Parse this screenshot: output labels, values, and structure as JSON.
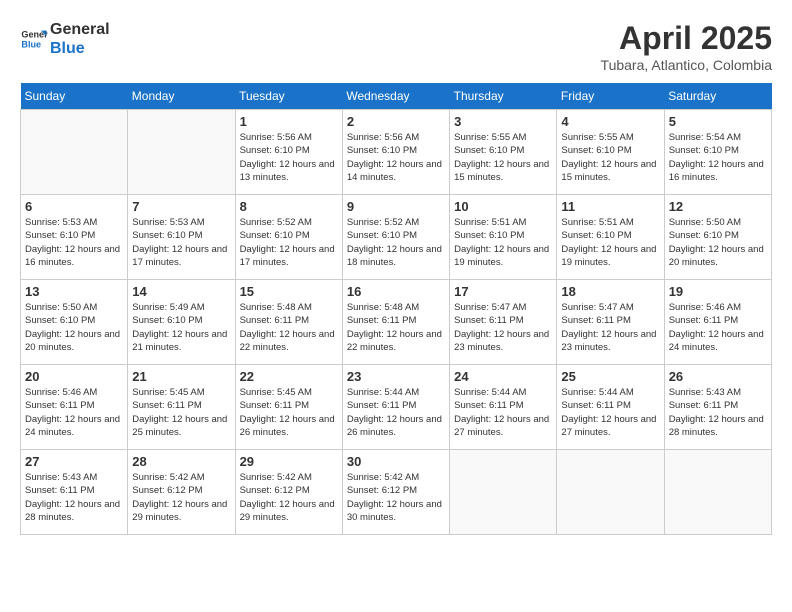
{
  "header": {
    "logo_line1": "General",
    "logo_line2": "Blue",
    "month": "April 2025",
    "location": "Tubara, Atlantico, Colombia"
  },
  "weekdays": [
    "Sunday",
    "Monday",
    "Tuesday",
    "Wednesday",
    "Thursday",
    "Friday",
    "Saturday"
  ],
  "weeks": [
    [
      {
        "day": "",
        "info": ""
      },
      {
        "day": "",
        "info": ""
      },
      {
        "day": "1",
        "info": "Sunrise: 5:56 AM\nSunset: 6:10 PM\nDaylight: 12 hours and 13 minutes."
      },
      {
        "day": "2",
        "info": "Sunrise: 5:56 AM\nSunset: 6:10 PM\nDaylight: 12 hours and 14 minutes."
      },
      {
        "day": "3",
        "info": "Sunrise: 5:55 AM\nSunset: 6:10 PM\nDaylight: 12 hours and 15 minutes."
      },
      {
        "day": "4",
        "info": "Sunrise: 5:55 AM\nSunset: 6:10 PM\nDaylight: 12 hours and 15 minutes."
      },
      {
        "day": "5",
        "info": "Sunrise: 5:54 AM\nSunset: 6:10 PM\nDaylight: 12 hours and 16 minutes."
      }
    ],
    [
      {
        "day": "6",
        "info": "Sunrise: 5:53 AM\nSunset: 6:10 PM\nDaylight: 12 hours and 16 minutes."
      },
      {
        "day": "7",
        "info": "Sunrise: 5:53 AM\nSunset: 6:10 PM\nDaylight: 12 hours and 17 minutes."
      },
      {
        "day": "8",
        "info": "Sunrise: 5:52 AM\nSunset: 6:10 PM\nDaylight: 12 hours and 17 minutes."
      },
      {
        "day": "9",
        "info": "Sunrise: 5:52 AM\nSunset: 6:10 PM\nDaylight: 12 hours and 18 minutes."
      },
      {
        "day": "10",
        "info": "Sunrise: 5:51 AM\nSunset: 6:10 PM\nDaylight: 12 hours and 19 minutes."
      },
      {
        "day": "11",
        "info": "Sunrise: 5:51 AM\nSunset: 6:10 PM\nDaylight: 12 hours and 19 minutes."
      },
      {
        "day": "12",
        "info": "Sunrise: 5:50 AM\nSunset: 6:10 PM\nDaylight: 12 hours and 20 minutes."
      }
    ],
    [
      {
        "day": "13",
        "info": "Sunrise: 5:50 AM\nSunset: 6:10 PM\nDaylight: 12 hours and 20 minutes."
      },
      {
        "day": "14",
        "info": "Sunrise: 5:49 AM\nSunset: 6:10 PM\nDaylight: 12 hours and 21 minutes."
      },
      {
        "day": "15",
        "info": "Sunrise: 5:48 AM\nSunset: 6:11 PM\nDaylight: 12 hours and 22 minutes."
      },
      {
        "day": "16",
        "info": "Sunrise: 5:48 AM\nSunset: 6:11 PM\nDaylight: 12 hours and 22 minutes."
      },
      {
        "day": "17",
        "info": "Sunrise: 5:47 AM\nSunset: 6:11 PM\nDaylight: 12 hours and 23 minutes."
      },
      {
        "day": "18",
        "info": "Sunrise: 5:47 AM\nSunset: 6:11 PM\nDaylight: 12 hours and 23 minutes."
      },
      {
        "day": "19",
        "info": "Sunrise: 5:46 AM\nSunset: 6:11 PM\nDaylight: 12 hours and 24 minutes."
      }
    ],
    [
      {
        "day": "20",
        "info": "Sunrise: 5:46 AM\nSunset: 6:11 PM\nDaylight: 12 hours and 24 minutes."
      },
      {
        "day": "21",
        "info": "Sunrise: 5:45 AM\nSunset: 6:11 PM\nDaylight: 12 hours and 25 minutes."
      },
      {
        "day": "22",
        "info": "Sunrise: 5:45 AM\nSunset: 6:11 PM\nDaylight: 12 hours and 26 minutes."
      },
      {
        "day": "23",
        "info": "Sunrise: 5:44 AM\nSunset: 6:11 PM\nDaylight: 12 hours and 26 minutes."
      },
      {
        "day": "24",
        "info": "Sunrise: 5:44 AM\nSunset: 6:11 PM\nDaylight: 12 hours and 27 minutes."
      },
      {
        "day": "25",
        "info": "Sunrise: 5:44 AM\nSunset: 6:11 PM\nDaylight: 12 hours and 27 minutes."
      },
      {
        "day": "26",
        "info": "Sunrise: 5:43 AM\nSunset: 6:11 PM\nDaylight: 12 hours and 28 minutes."
      }
    ],
    [
      {
        "day": "27",
        "info": "Sunrise: 5:43 AM\nSunset: 6:11 PM\nDaylight: 12 hours and 28 minutes."
      },
      {
        "day": "28",
        "info": "Sunrise: 5:42 AM\nSunset: 6:12 PM\nDaylight: 12 hours and 29 minutes."
      },
      {
        "day": "29",
        "info": "Sunrise: 5:42 AM\nSunset: 6:12 PM\nDaylight: 12 hours and 29 minutes."
      },
      {
        "day": "30",
        "info": "Sunrise: 5:42 AM\nSunset: 6:12 PM\nDaylight: 12 hours and 30 minutes."
      },
      {
        "day": "",
        "info": ""
      },
      {
        "day": "",
        "info": ""
      },
      {
        "day": "",
        "info": ""
      }
    ]
  ]
}
